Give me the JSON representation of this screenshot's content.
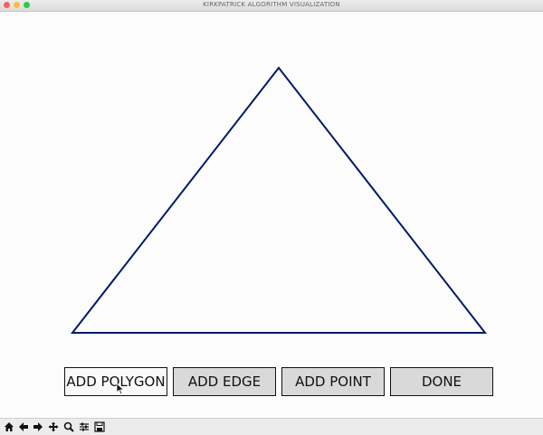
{
  "window": {
    "title": "KIRKPATRICK ALGORITHM VISUALIZATION"
  },
  "canvas": {
    "shape": "triangle",
    "stroke_color": "#001a66"
  },
  "buttons": [
    {
      "label": "ADD POLYGON",
      "state": "active"
    },
    {
      "label": "ADD EDGE"
    },
    {
      "label": "ADD POINT"
    },
    {
      "label": "DONE"
    }
  ],
  "toolbar": {
    "icons": [
      "home-icon",
      "back-arrow-icon",
      "forward-arrow-icon",
      "pan-icon",
      "zoom-icon",
      "configure-icon",
      "save-icon"
    ]
  }
}
